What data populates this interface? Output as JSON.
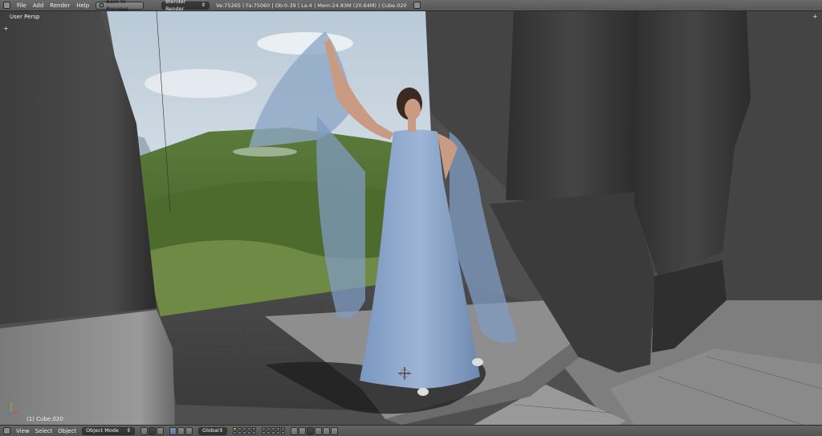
{
  "topbar": {
    "menu": [
      "File",
      "Add",
      "Render",
      "Help"
    ],
    "back_button": "Back to Previous",
    "render_engine": "Blender Render",
    "stats": "Ve:75265 | Fa:75060 | Ob:0-39 | La:4 | Mem:24.83M (20.64M) | Cube.020"
  },
  "viewport": {
    "view_name": "User Persp",
    "active_object": "(1) Cube.020"
  },
  "bottombar": {
    "menu": [
      "View",
      "Select",
      "Object"
    ],
    "mode": "Object Mode",
    "orientation": "Global"
  },
  "icons": {
    "editor_type": "info-icon",
    "screen": "screen-icon",
    "axis": "axis-gizmo-icon"
  }
}
